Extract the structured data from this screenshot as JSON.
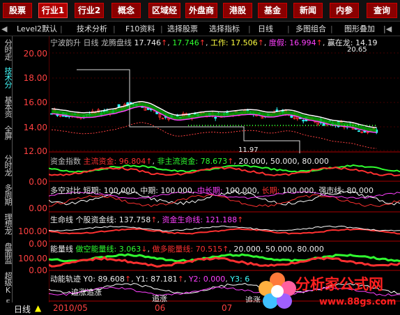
{
  "nav": {
    "items": [
      "股票",
      "行业1",
      "行业2",
      "概念",
      "区域经",
      "外盘商",
      "港股",
      "基金",
      "新闻",
      "内参",
      "查询"
    ],
    "active_index": 1
  },
  "toolbar": {
    "back": "◀",
    "level2": "Level2默认",
    "tech": "技术分析",
    "f10": "F10资料",
    "pick_stock": "选择股票",
    "pick_indicator": "选择指标",
    "period": "日线",
    "multi": "多图组合",
    "overlay": "图形叠加",
    "more": "|◀"
  },
  "lefttabs": [
    "分时走",
    "技术分",
    "基本资",
    "全屏",
    "分时龙",
    "多周期",
    "理想龙",
    "盘面监",
    "超级K",
    "F1"
  ],
  "main_panel": {
    "stock": "宁波韵升",
    "period": "日线",
    "indicator": "龙腾盘线",
    "v1": "17.746",
    "v2": "17.746",
    "work_label": "工作:",
    "work_value": "17.506",
    "bull_label": "度假:",
    "bull_value": "16.994",
    "dragon_label": "赢在龙:",
    "dragon_value": "14.19",
    "price_high_label": "20.65",
    "price_low_label": "11.97",
    "yaxis": [
      "20.00",
      "18.00",
      "16.00",
      "14.00",
      "12.00"
    ]
  },
  "panel2": {
    "name": "资金指数",
    "main_label": "主流资金:",
    "main_value": "96.804",
    "nonmain_label": "非主流资金:",
    "nonmain_value": "78.673",
    "lines": "20.000, 50.000, 80.000",
    "yaxis": "0.00"
  },
  "panel3": {
    "name": "多空对比",
    "short_label": "短期:",
    "short_value": "100.000,",
    "mid_label": "中期:",
    "mid_value": "100.000,",
    "midlong_label": "中长期:",
    "midlong_value": "100.000,",
    "long_label": "长期:",
    "long_value": "100.000,",
    "strong_label": "强市线:",
    "strong_value": "80.000",
    "yaxis": "0.00"
  },
  "panel4": {
    "name": "生命线",
    "stock_label": "个股资金线:",
    "stock_value": "137.758",
    "life_label": "资金生命线:",
    "life_value": "121.188",
    "yaxis": [
      "100.00",
      "0.00"
    ]
  },
  "panel5": {
    "name": "能量线",
    "long_label": "做空能量线:",
    "long_value": "3.063",
    "short_label": "做多能量线:",
    "short_value": "70.515",
    "lines": "20.000, 50.000, 80.000",
    "yaxis": [
      "100.00",
      "0.00"
    ]
  },
  "panel6": {
    "name": "动能轨迹",
    "y0_label": "Y0:",
    "y0_value": "89.608",
    "y1_label": "Y1:",
    "y1_value": "87.181",
    "y2_label": "Y2:",
    "y2_value": "0.000",
    "y3_label": "Y3:",
    "y3_value": "6",
    "tag1": "追涨",
    "tag2": "追涨",
    "tag3": "追涨",
    "tag4": "追涨"
  },
  "bottom": {
    "period": "日线",
    "date": "2010/05",
    "m06": "06",
    "m07": "07"
  },
  "logo": {
    "title": "分析家公式网",
    "url": "www.88gs.com"
  },
  "colors": {
    "nav_bg": "#8a0000",
    "axis_red": "#ff3030",
    "up": "#ff3030",
    "down": "#30ffff",
    "green_band": "#00b000"
  }
}
